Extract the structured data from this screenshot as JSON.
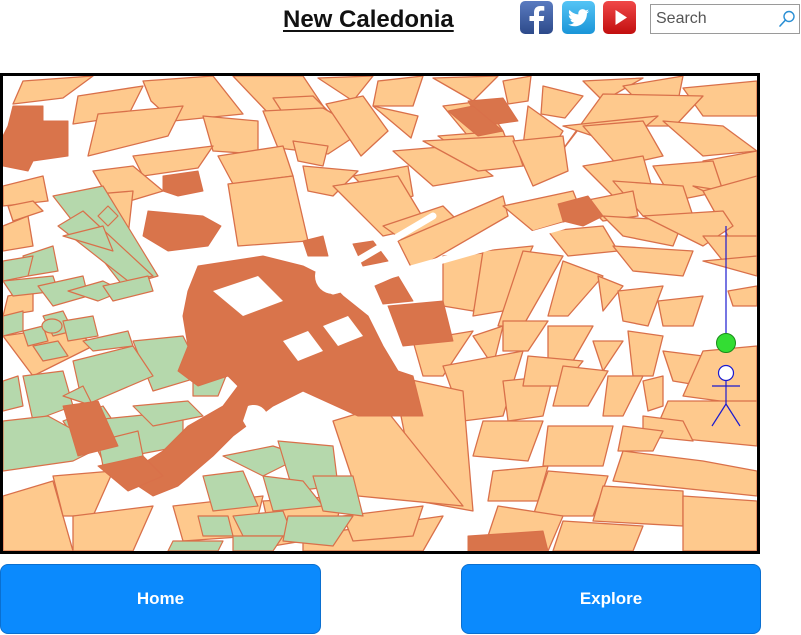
{
  "header": {
    "title": "New Caledonia"
  },
  "social": [
    {
      "name": "facebook-icon",
      "color": "#3b5998"
    },
    {
      "name": "twitter-icon",
      "color": "#1da1f2"
    },
    {
      "name": "youtube-icon",
      "color": "#e21b1b"
    }
  ],
  "search": {
    "placeholder": "Search",
    "value": "",
    "icon": "search-icon"
  },
  "map": {
    "colors": {
      "block": "#fec98d",
      "block_stroke": "#d9704a",
      "landmark": "#d9744b",
      "park": "#b5d8ac",
      "road": "#ffffff"
    },
    "marker": {
      "color": "#33dd33",
      "icon": "location-pin-icon"
    },
    "figure": {
      "icon": "person-icon",
      "color": "#1a1ad0"
    }
  },
  "buttons": {
    "home": "Home",
    "explore": "Explore"
  }
}
